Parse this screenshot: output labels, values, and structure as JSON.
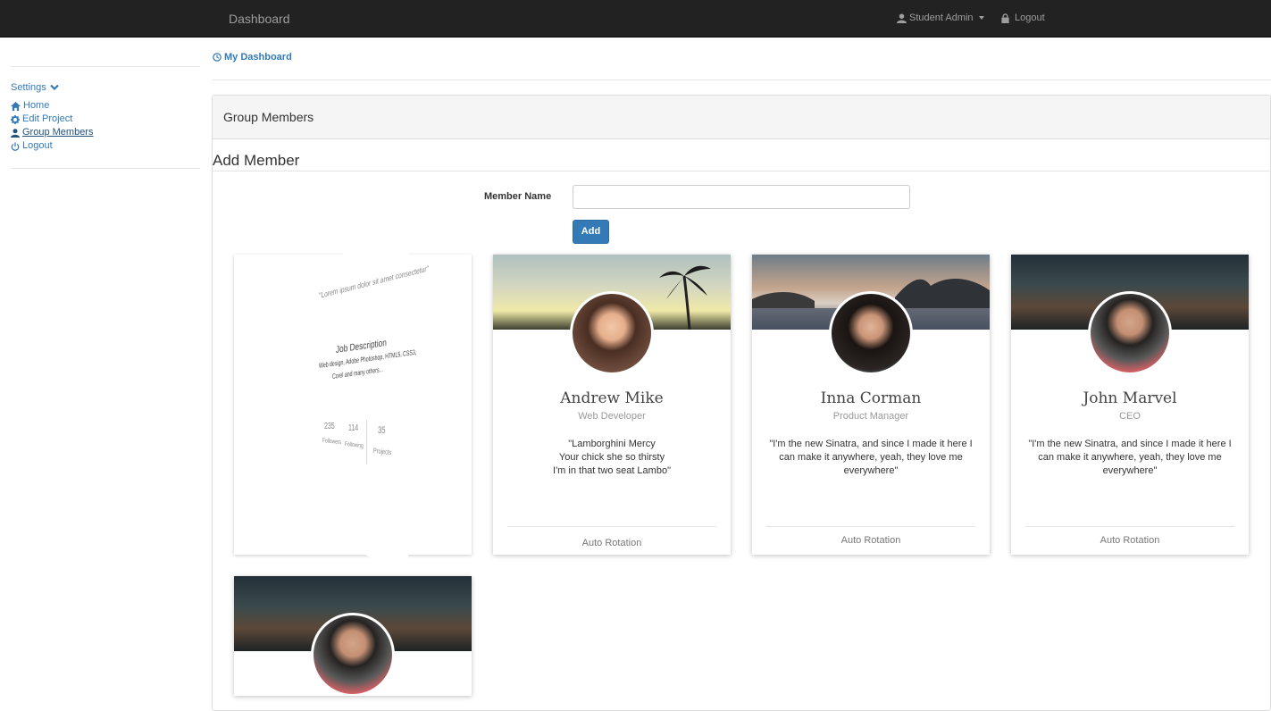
{
  "navbar": {
    "brand": "Dashboard",
    "user_label": "Student Admin",
    "logout_label": "Logout"
  },
  "sidebar": {
    "settings_label": "Settings",
    "items": [
      {
        "label": "Home",
        "icon": "home-icon"
      },
      {
        "label": "Edit Project",
        "icon": "gear-icon"
      },
      {
        "label": "Group Members",
        "icon": "user-icon",
        "active": true
      },
      {
        "label": "Logout",
        "icon": "power-icon"
      }
    ]
  },
  "breadcrumb": {
    "label": "My Dashboard"
  },
  "panel": {
    "title": "Group Members",
    "add_title": "Add Member",
    "member_name_label": "Member Name",
    "member_name_value": "",
    "add_button": "Add"
  },
  "flip_card": {
    "quote": "\"Lorem ipsum dolor sit amet consectetur\"",
    "job_title": "Job Description",
    "job_desc_1": "Web design, Adobe Photoshop, HTML5, CSS3,",
    "job_desc_2": "Corel and many others...",
    "stats": [
      {
        "value": "235",
        "label": "Followers"
      },
      {
        "value": "114",
        "label": "Following"
      },
      {
        "value": "35",
        "label": "Projects"
      }
    ]
  },
  "cards": [
    {
      "name": "Andrew Mike",
      "role": "Web Developer",
      "quote_lines": [
        "\"Lamborghini Mercy",
        "Your chick she so thirsty",
        "I'm in that two seat Lambo\""
      ],
      "footer": "Auto Rotation"
    },
    {
      "name": "Inna Corman",
      "role": "Product Manager",
      "quote_lines": [
        "\"I'm the new Sinatra, and since I made it here I",
        "can make it anywhere, yeah, they love me",
        "everywhere\""
      ],
      "footer": "Auto Rotation"
    },
    {
      "name": "John Marvel",
      "role": "CEO",
      "quote_lines": [
        "\"I'm the new Sinatra, and since I made it here I",
        "can make it anywhere, yeah, they love me",
        "everywhere\""
      ],
      "footer": "Auto Rotation"
    }
  ],
  "colors": {
    "navbar_bg": "#222222",
    "link": "#337ab7",
    "button_primary": "#337ab7"
  }
}
